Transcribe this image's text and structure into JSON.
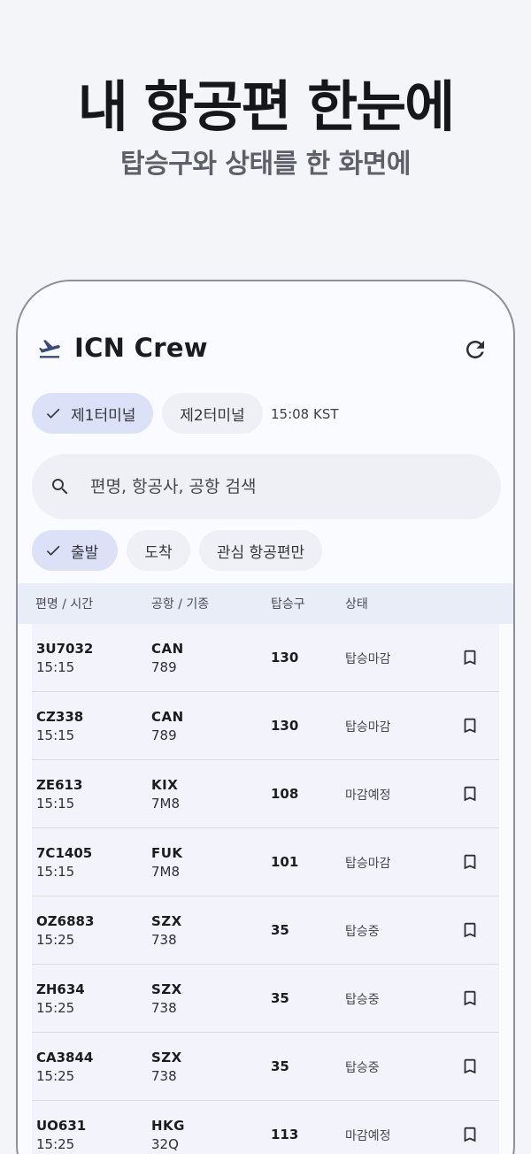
{
  "promo": {
    "title": "내 항공편 한눈에",
    "subtitle": "탑승구와 상태를 한 화면에"
  },
  "app": {
    "title": "ICN Crew",
    "icon": "flight-takeoff-icon",
    "refresh_icon": "refresh-icon"
  },
  "terminals": {
    "t1_label": "제1터미널",
    "t2_label": "제2터미널",
    "selected": "제1터미널"
  },
  "clock": "15:08 KST",
  "search": {
    "placeholder": "편명, 항공사, 공항 검색"
  },
  "filters": {
    "departure_label": "출발",
    "arrival_label": "도착",
    "watchlist_label": "관심 항공편만",
    "selected": "출발"
  },
  "table": {
    "headers": {
      "flight_time": "편명 / 시간",
      "airport_type": "공항 / 기종",
      "gate": "탑승구",
      "status": "상태"
    },
    "rows": [
      {
        "flight": "3U7032",
        "time": "15:15",
        "airport": "CAN",
        "aircraft": "789",
        "gate": "130",
        "status": "탑승마감"
      },
      {
        "flight": "CZ338",
        "time": "15:15",
        "airport": "CAN",
        "aircraft": "789",
        "gate": "130",
        "status": "탑승마감"
      },
      {
        "flight": "ZE613",
        "time": "15:15",
        "airport": "KIX",
        "aircraft": "7M8",
        "gate": "108",
        "status": "마감예정"
      },
      {
        "flight": "7C1405",
        "time": "15:15",
        "airport": "FUK",
        "aircraft": "7M8",
        "gate": "101",
        "status": "탑승마감"
      },
      {
        "flight": "OZ6883",
        "time": "15:25",
        "airport": "SZX",
        "aircraft": "738",
        "gate": "35",
        "status": "탑승중"
      },
      {
        "flight": "ZH634",
        "time": "15:25",
        "airport": "SZX",
        "aircraft": "738",
        "gate": "35",
        "status": "탑승중"
      },
      {
        "flight": "CA3844",
        "time": "15:25",
        "airport": "SZX",
        "aircraft": "738",
        "gate": "35",
        "status": "탑승중"
      },
      {
        "flight": "UO631",
        "time": "15:25",
        "airport": "HKG",
        "aircraft": "32Q",
        "gate": "113",
        "status": "마감예정"
      }
    ]
  },
  "colors": {
    "accent_chip": "#dde1f8",
    "header_band": "#e8edf7",
    "row_bg": "#f3f4fb",
    "icon_navy": "#3c4a7a"
  }
}
